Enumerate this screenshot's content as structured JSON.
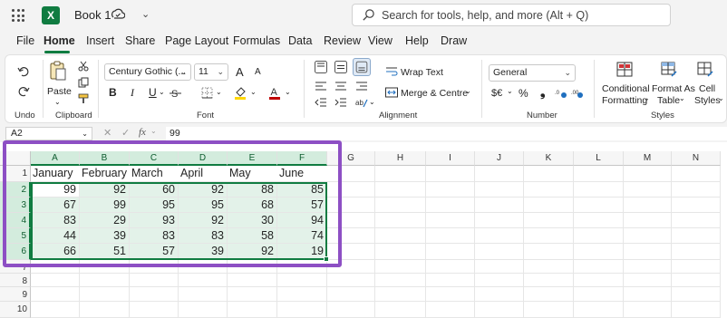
{
  "title_bar": {
    "app_logo": "X",
    "workbook_name": "Book 1",
    "search_placeholder": "Search for tools, help, and more (Alt + Q)"
  },
  "menu": {
    "tabs": [
      "File",
      "Home",
      "Insert",
      "Share",
      "Page Layout",
      "Formulas",
      "Data",
      "Review",
      "View",
      "Help",
      "Draw"
    ],
    "active_tab": "Home"
  },
  "ribbon": {
    "undo_group": "Undo",
    "clipboard": {
      "paste": "Paste",
      "group": "Clipboard"
    },
    "font": {
      "name": "Century Gothic (...",
      "size": "11",
      "grow": "A",
      "shrink": "A",
      "bold": "B",
      "italic": "I",
      "underline": "U",
      "group": "Font",
      "font_color": "#c00000",
      "fill_color": "#ffd700"
    },
    "alignment": {
      "wrap_text": "Wrap Text",
      "merge_center": "Merge & Centre",
      "group": "Alignment"
    },
    "number": {
      "format": "General",
      "currency": "$€",
      "percent": "%",
      "comma": "❟",
      "group": "Number"
    },
    "styles": {
      "conditional_line1": "Conditional",
      "conditional_line2": "Formatting",
      "format_table_line1": "Format As",
      "format_table_line2": "Table",
      "cell_styles_line1": "Cell",
      "cell_styles_line2": "Styles",
      "group": "Styles"
    }
  },
  "formula_bar": {
    "name_box": "A2",
    "fx": "fx",
    "value": "99"
  },
  "sheet": {
    "columns": [
      "A",
      "B",
      "C",
      "D",
      "E",
      "F",
      "G",
      "H",
      "I",
      "J",
      "K",
      "L",
      "M",
      "N"
    ],
    "rows": [
      "1",
      "2",
      "3",
      "4",
      "5",
      "6",
      "7",
      "8",
      "9",
      "10"
    ],
    "headers": [
      "January",
      "February",
      "March",
      "April",
      "May",
      "June"
    ],
    "data": [
      [
        99,
        92,
        60,
        92,
        88,
        85
      ],
      [
        67,
        99,
        95,
        95,
        68,
        57
      ],
      [
        83,
        29,
        93,
        92,
        30,
        94
      ],
      [
        44,
        39,
        83,
        83,
        58,
        74
      ],
      [
        66,
        51,
        57,
        39,
        92,
        19
      ]
    ],
    "active_cell": "A2",
    "selection": "A2:F6"
  },
  "colors": {
    "brand_green": "#107c41",
    "selection_fill": "#e3f2e9",
    "highlight_box": "#8d4fc4"
  }
}
